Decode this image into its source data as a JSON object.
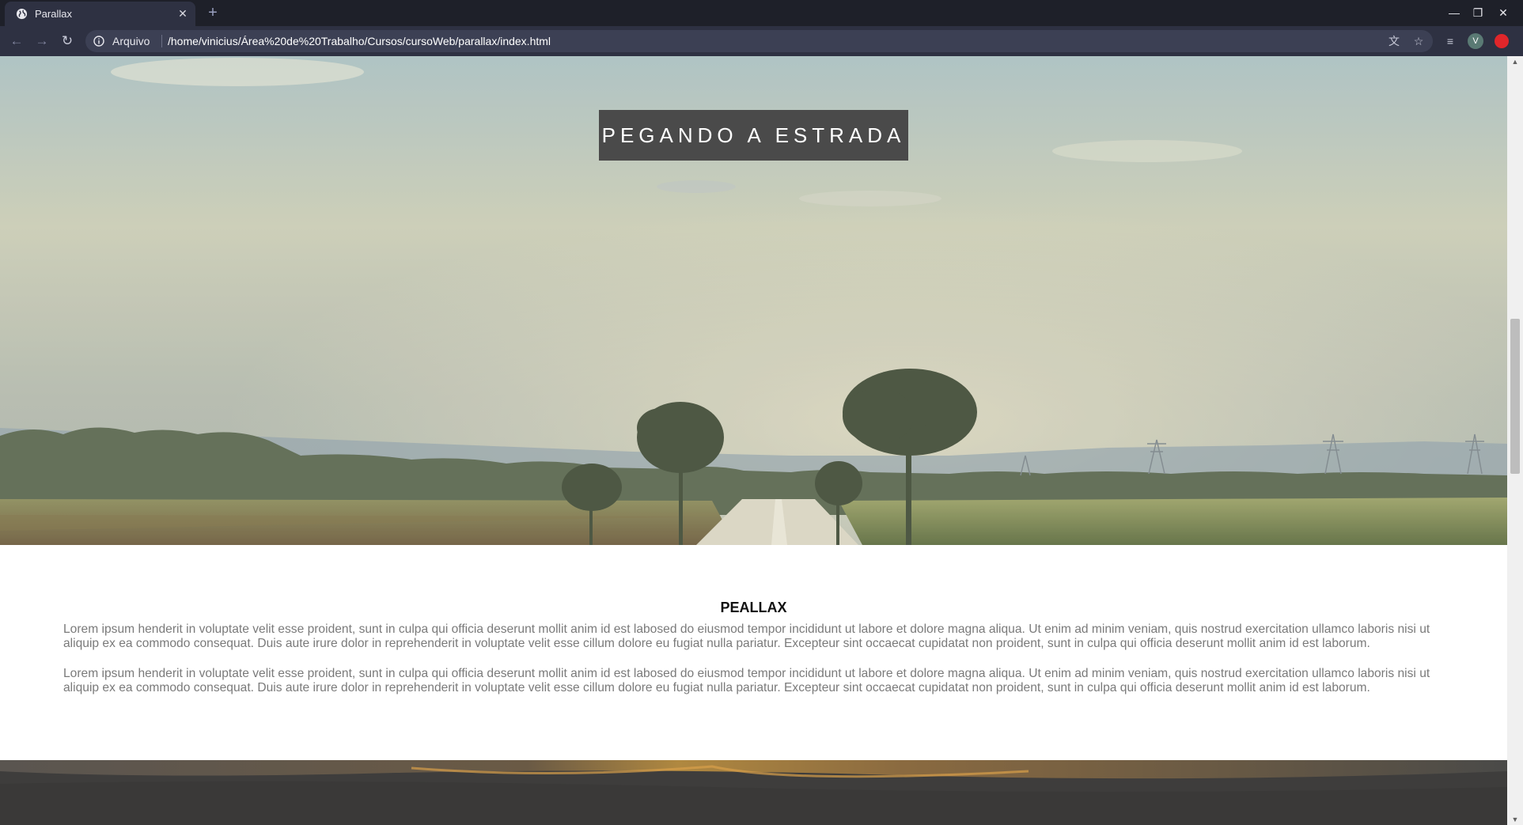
{
  "browser": {
    "tab": {
      "title": "Parallax",
      "close_glyph": "✕"
    },
    "new_tab_glyph": "+",
    "window_controls": {
      "minimize": "—",
      "maximize": "❐",
      "close": "✕"
    },
    "nav": {
      "back": "←",
      "forward": "→",
      "reload": "↻"
    },
    "omnibox": {
      "scheme_label": "Arquivo",
      "url": "/home/vinicius/Área%20de%20Trabalho/Cursos/cursoWeb/parallax/index.html"
    },
    "profile_initial": "V"
  },
  "page": {
    "hero_title": "PEGANDO A ESTRADA",
    "section_heading": "PEALLAX",
    "paragraphs": [
      "Lorem ipsum henderit in voluptate velit esse proident, sunt in culpa qui officia deserunt mollit anim id est labosed do eiusmod tempor incididunt ut labore et dolore magna aliqua. Ut enim ad minim veniam, quis nostrud exercitation ullamco laboris nisi ut aliquip ex ea commodo consequat. Duis aute irure dolor in reprehenderit in voluptate velit esse cillum dolore eu fugiat nulla pariatur. Excepteur sint occaecat cupidatat non proident, sunt in culpa qui officia deserunt mollit anim id est laborum.",
      "Lorem ipsum henderit in voluptate velit esse proident, sunt in culpa qui officia deserunt mollit anim id est labosed do eiusmod tempor incididunt ut labore et dolore magna aliqua. Ut enim ad minim veniam, quis nostrud exercitation ullamco laboris nisi ut aliquip ex ea commodo consequat. Duis aute irure dolor in reprehenderit in voluptate velit esse cillum dolore eu fugiat nulla pariatur. Excepteur sint occaecat cupidatat non proident, sunt in culpa qui officia deserunt mollit anim id est laborum."
    ]
  },
  "icons": {
    "favicon": "globe-icon",
    "info": "info-icon",
    "translate": "translate-icon",
    "bookmark": "star-icon",
    "media": "media-control-icon",
    "extension": "extension-icon"
  },
  "colors": {
    "chrome_dark": "#1e2029",
    "chrome_toolbar": "#2e3142",
    "omnibox": "#3c4054",
    "hero_title_bg": "#4a4a4a",
    "body_text": "#7a7a7a"
  }
}
